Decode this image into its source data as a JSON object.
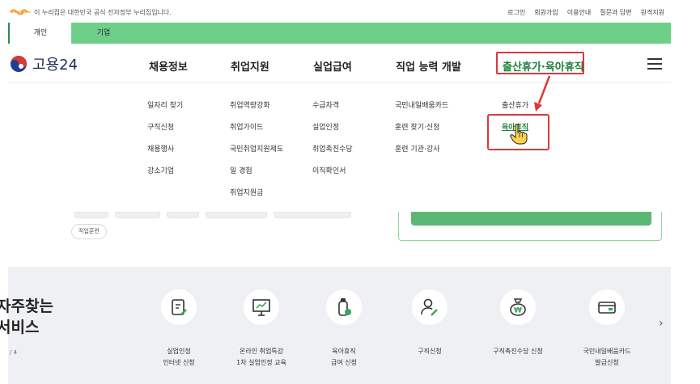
{
  "notice": {
    "text": "이 누리집은 대한민국 공식 전자정부 누리집입니다."
  },
  "utility_links": [
    "로그인",
    "회원가입",
    "이용안내",
    "질문과 답변",
    "원격지원"
  ],
  "user_tabs": {
    "person": "개인",
    "business": "기업"
  },
  "logo": {
    "text": "고용24"
  },
  "gnb": [
    "채용정보",
    "취업지원",
    "실업급여",
    "직업 능력 개발",
    "출산휴가·육아휴직"
  ],
  "submenus": {
    "jobs": [
      "일자리 찾기",
      "구직신청",
      "채용행사",
      "강소기업"
    ],
    "support": [
      "취업역량강화",
      "취업가이드",
      "국민취업지원제도",
      "일 경험",
      "취업지원금"
    ],
    "unemployment": [
      "수급자격",
      "실업인정",
      "취업촉진수당",
      "이직확인서"
    ],
    "training": [
      "국민내일배움카드",
      "훈련 찾기·신청",
      "훈련 기관·강사"
    ],
    "leave": [
      "출산휴가",
      "육아휴직"
    ]
  },
  "background": {
    "tag": "직업훈련"
  },
  "services": {
    "title": "자주찾는\n서비스",
    "page": "/ 4",
    "items": [
      {
        "label": "실업인정\n인터넷 신청",
        "icon": "document-pen-icon"
      },
      {
        "label": "온라인 취업특강\n1차 실업인정 교육",
        "icon": "presentation-board-icon"
      },
      {
        "label": "육아휴직\n급여 신청",
        "icon": "baby-bottle-icon"
      },
      {
        "label": "구직신청",
        "icon": "person-pen-icon"
      },
      {
        "label": "구직촉진수당 신청",
        "icon": "money-bag-icon"
      },
      {
        "label": "국민내일배움카드\n발급신청",
        "icon": "card-icon"
      }
    ]
  },
  "colors": {
    "green": "#6ecf88",
    "highlight_red": "#d9393b",
    "active_green": "#1a7f3c"
  }
}
